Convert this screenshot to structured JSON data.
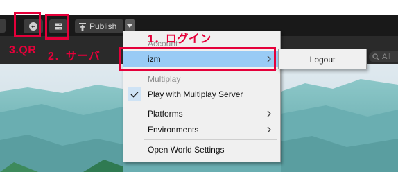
{
  "toolbar": {
    "qr_icon": "qr-code-icon",
    "server_icon": "server-icon",
    "publish_label": "Publish",
    "publish_icon": "upload-arrow-icon",
    "dropdown_icon": "triangle-down-icon"
  },
  "search": {
    "placeholder": "All",
    "icon": "search-icon"
  },
  "menu": {
    "account_header": "Account",
    "user_item": "izm",
    "multiplay_header": "Multiplay",
    "multiplay_item": "Play with Multiplay Server",
    "platforms_item": "Platforms",
    "environments_item": "Environments",
    "open_world_item": "Open World Settings"
  },
  "submenu": {
    "logout_label": "Logout"
  },
  "annotations": {
    "qr_note": "3.QR",
    "server_note": "2．サーバ",
    "login_note": "1．ログイン",
    "highlight_color": "#e5003a"
  },
  "colors": {
    "toolbar_bg": "#191919",
    "menu_bg": "#f0f0f0",
    "selection": "#99cbf5",
    "terrain": "#6fb3b5"
  }
}
